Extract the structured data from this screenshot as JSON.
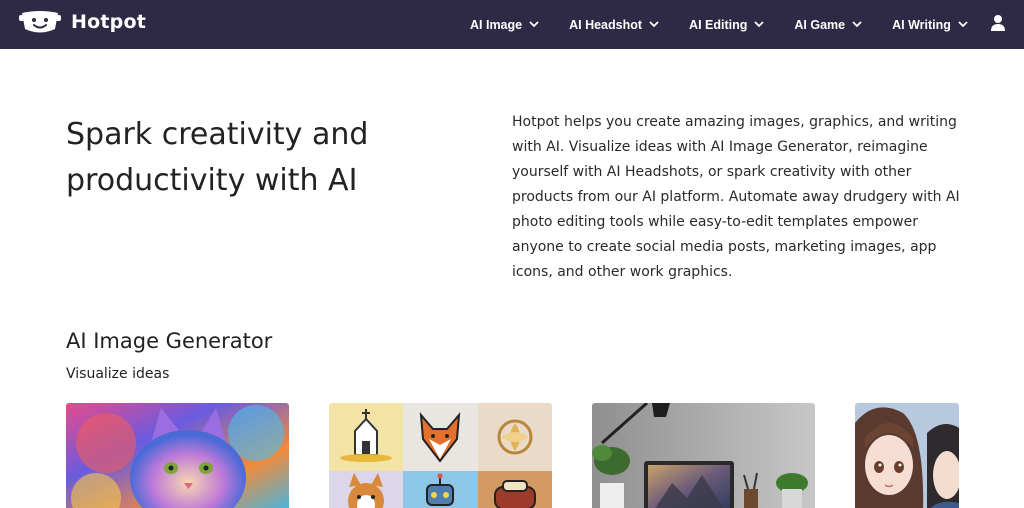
{
  "brand": {
    "name": "Hotpot",
    "logo_icon": "smiling-pot-logo"
  },
  "nav": {
    "items": [
      {
        "label": "AI Image"
      },
      {
        "label": "AI Headshot"
      },
      {
        "label": "AI Editing"
      },
      {
        "label": "AI Game"
      },
      {
        "label": "AI Writing"
      }
    ],
    "user_icon": "user-icon"
  },
  "hero": {
    "title": "Spark creativity and productivity with AI",
    "description": "Hotpot helps you create amazing images, graphics, and writing with AI. Visualize ideas with AI Image Generator, reimagine yourself with AI Headshots, or spark creativity with other products from our AI platform. Automate away drudgery with AI photo editing tools while easy-to-edit templates empower anyone to create social media posts, marketing images, app icons, and other work graphics."
  },
  "section": {
    "title": "AI Image Generator",
    "subtitle": "Visualize ideas"
  },
  "cards": [
    {
      "subject": "colorful-cat-image"
    },
    {
      "subject": "icon-grid-image"
    },
    {
      "subject": "desk-laptop-image"
    },
    {
      "subject": "anime-girls-image"
    }
  ],
  "colors": {
    "navbar": "#2e2a45",
    "text": "#222222",
    "background": "#ffffff"
  }
}
